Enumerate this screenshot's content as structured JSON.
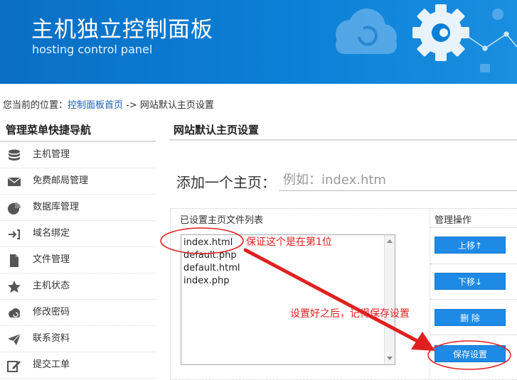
{
  "header": {
    "title": "主机独立控制面板",
    "subtitle": "hosting control panel"
  },
  "breadcrumb": {
    "prefix": "您当前的位置：",
    "home_link": "控制面板首页",
    "separator": " -> ",
    "current": "网站默认主页设置"
  },
  "sidebar": {
    "title": "管理菜单快捷导航",
    "items": [
      {
        "label": "主机管理",
        "icon": "database-icon"
      },
      {
        "label": "免费邮局管理",
        "icon": "mail-icon"
      },
      {
        "label": "数据库管理",
        "icon": "pie-chart-icon"
      },
      {
        "label": "域名绑定",
        "icon": "arrow-in-icon"
      },
      {
        "label": "文件管理",
        "icon": "file-icon"
      },
      {
        "label": "主机状态",
        "icon": "star-icon"
      },
      {
        "label": "修改密码",
        "icon": "cloud-icon"
      },
      {
        "label": "联系资料",
        "icon": "send-icon"
      },
      {
        "label": "提交工单",
        "icon": "edit-icon"
      }
    ]
  },
  "main": {
    "title": "网站默认主页设置",
    "add_label": "添加一个主页：",
    "add_placeholder": "例如：index.htm",
    "list_header": "已设置主页文件列表",
    "ops_header": "管理操作",
    "files": [
      "index.html",
      "default.php",
      "default.html",
      "index.php"
    ],
    "buttons": {
      "up": "上移↑",
      "down": "下移↓",
      "delete": "删 除",
      "save": "保存设置"
    }
  },
  "annotations": {
    "first_note": "保证这个是在第1位",
    "save_note": "设置好之后，记得保存设置",
    "color": "#e02020"
  },
  "colors": {
    "banner": "#0b7fd6",
    "button": "#1e8ae6",
    "link": "#1a5fb4"
  }
}
